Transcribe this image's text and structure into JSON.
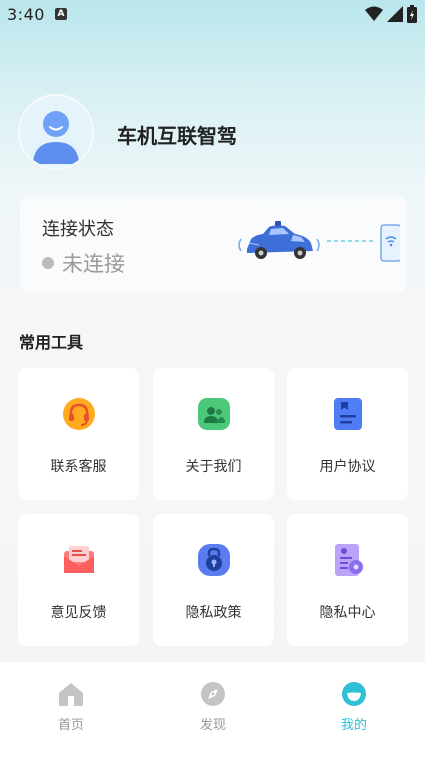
{
  "status_bar": {
    "time": "3:40",
    "notification_badge": "A"
  },
  "profile": {
    "app_name": "车机互联智驾"
  },
  "connection": {
    "title": "连接状态",
    "status": "未连接"
  },
  "tools": {
    "section_title": "常用工具",
    "items": [
      {
        "label": "联系客服",
        "icon": "headset-icon",
        "color": "#ffaa1f"
      },
      {
        "label": "关于我们",
        "icon": "team-icon",
        "color": "#4cc87a"
      },
      {
        "label": "用户协议",
        "icon": "document-icon",
        "color": "#4f7df5"
      },
      {
        "label": "意见反馈",
        "icon": "mail-icon",
        "color": "#ff6b6b"
      },
      {
        "label": "隐私政策",
        "icon": "lock-icon",
        "color": "#5b7cf0"
      },
      {
        "label": "隐私中心",
        "icon": "privacy-settings-icon",
        "color": "#9a7cf2"
      }
    ]
  },
  "tabbar": {
    "items": [
      {
        "label": "首页",
        "icon": "home-icon"
      },
      {
        "label": "发现",
        "icon": "compass-icon"
      },
      {
        "label": "我的",
        "icon": "profile-face-icon",
        "active": true
      }
    ],
    "active_color": "#2ec0d6"
  }
}
